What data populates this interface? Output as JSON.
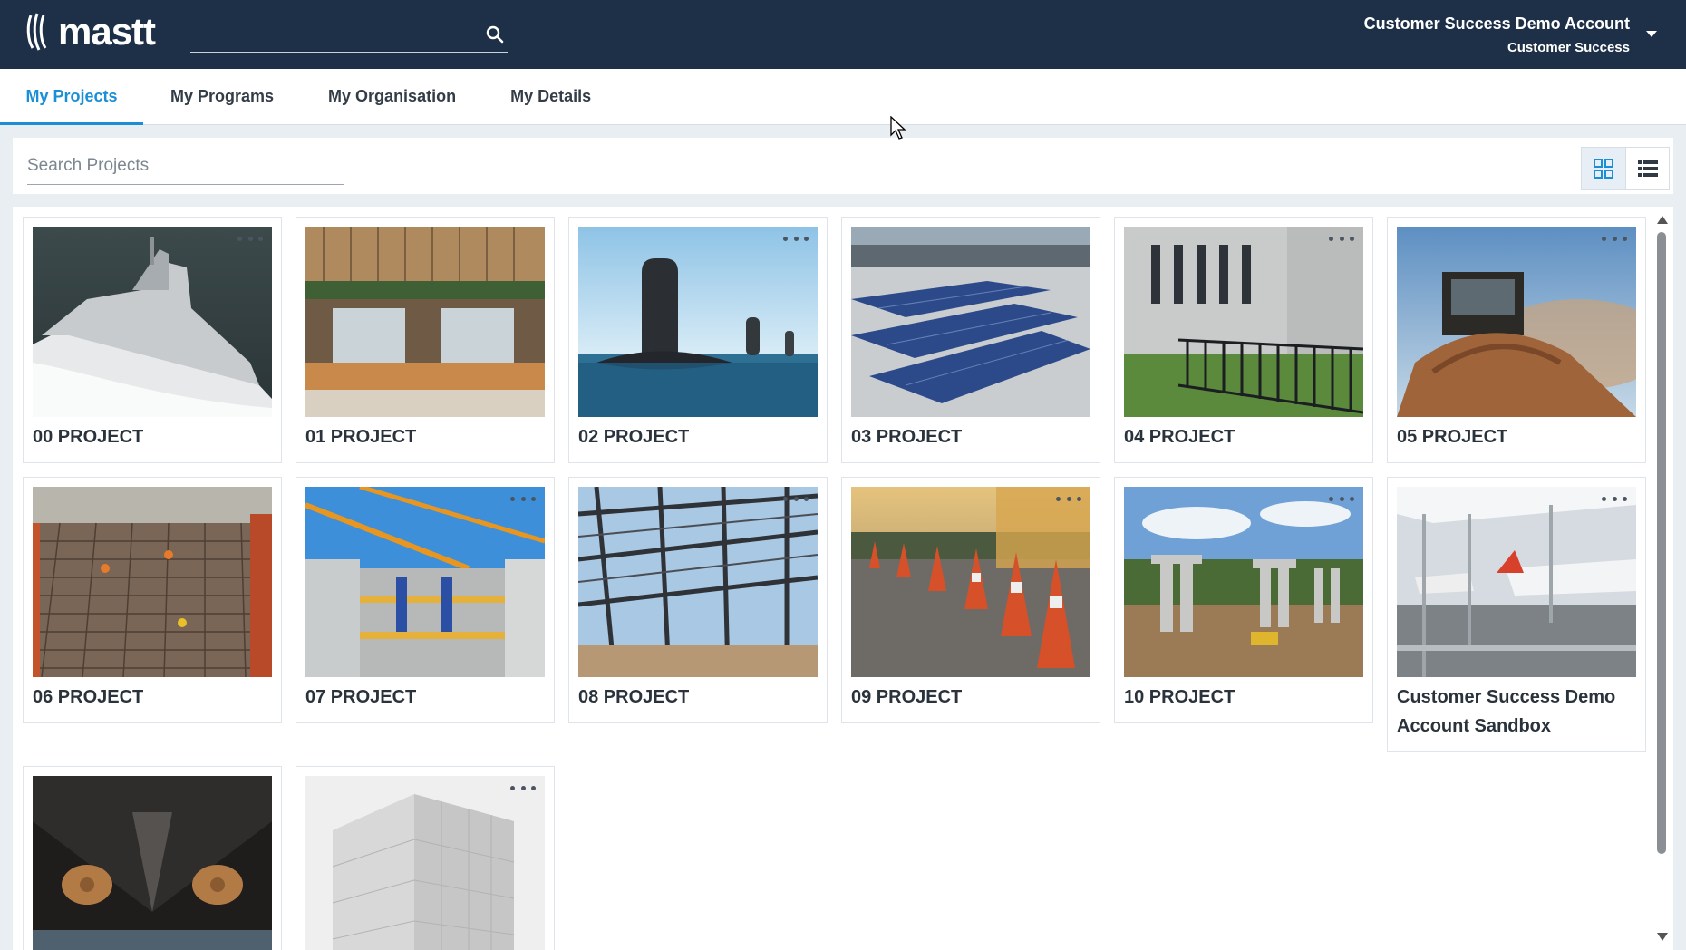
{
  "header": {
    "logo_text": "mastt",
    "search_value": "",
    "account_name": "Customer Success Demo Account",
    "account_role": "Customer Success"
  },
  "tabs": [
    {
      "label": "My Projects",
      "active": true
    },
    {
      "label": "My Programs",
      "active": false
    },
    {
      "label": "My Organisation",
      "active": false
    },
    {
      "label": "My Details",
      "active": false
    }
  ],
  "filter": {
    "search_placeholder": "Search Projects",
    "view_mode": "grid"
  },
  "projects": [
    {
      "title": "00 PROJECT",
      "image": "naval-ship"
    },
    {
      "title": "01 PROJECT",
      "image": "restaurant-interior"
    },
    {
      "title": "02 PROJECT",
      "image": "submarines"
    },
    {
      "title": "03 PROJECT",
      "image": "solar-panels"
    },
    {
      "title": "04 PROJECT",
      "image": "building-fence"
    },
    {
      "title": "05 PROJECT",
      "image": "bulldozer"
    },
    {
      "title": "06 PROJECT",
      "image": "rebar-deck"
    },
    {
      "title": "07 PROJECT",
      "image": "cranes-construction"
    },
    {
      "title": "08 PROJECT",
      "image": "steel-roof-frame"
    },
    {
      "title": "09 PROJECT",
      "image": "traffic-cones"
    },
    {
      "title": "10 PROJECT",
      "image": "bridge-piers"
    },
    {
      "title": "Customer Success Demo Account Sandbox",
      "image": "airport-apron"
    },
    {
      "title": "",
      "image": "ship-propellers"
    },
    {
      "title": "",
      "image": "glass-building"
    }
  ],
  "colors": {
    "header_bg": "#1d3048",
    "accent": "#1a8fd6",
    "page_bg": "#e9eef3"
  }
}
